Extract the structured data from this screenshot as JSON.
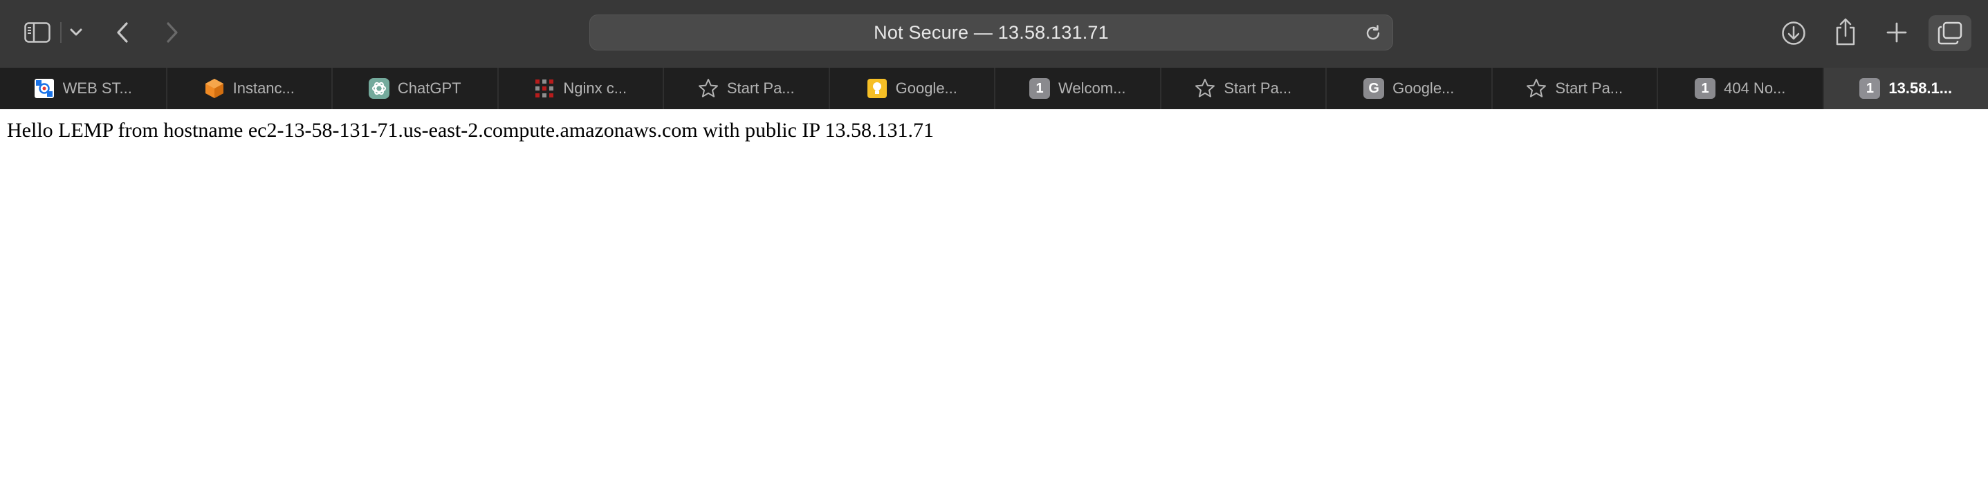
{
  "address_bar": {
    "text": "Not Secure — 13.58.131.71"
  },
  "tabs": [
    {
      "title": "WEB ST...",
      "icon": "web-st-favicon"
    },
    {
      "title": "Instanc...",
      "icon": "aws-ec2-favicon"
    },
    {
      "title": "ChatGPT",
      "icon": "chatgpt-favicon"
    },
    {
      "title": "Nginx c...",
      "icon": "nginx-favicon"
    },
    {
      "title": "Start Pa...",
      "icon": "star-icon"
    },
    {
      "title": "Google...",
      "icon": "google-keep-favicon"
    },
    {
      "title": "Welcom...",
      "icon": "number-badge",
      "badge": "1"
    },
    {
      "title": "Start Pa...",
      "icon": "star-icon"
    },
    {
      "title": "Google...",
      "icon": "letter-badge",
      "badge": "G"
    },
    {
      "title": "Start Pa...",
      "icon": "star-icon"
    },
    {
      "title": "404 No...",
      "icon": "number-badge",
      "badge": "1"
    },
    {
      "title": "13.58.1...",
      "icon": "number-badge",
      "badge": "1",
      "active": true
    }
  ],
  "page": {
    "text": "Hello LEMP from hostname ec2-13-58-131-71.us-east-2.compute.amazonaws.com with public IP 13.58.131.71"
  },
  "colors": {
    "toolbar_bg": "#383838",
    "tabstrip_bg": "#1f1f1f",
    "active_tab_bg": "#3d3d3d",
    "address_bar_bg": "#4a4a4a",
    "page_bg": "#ffffff"
  }
}
